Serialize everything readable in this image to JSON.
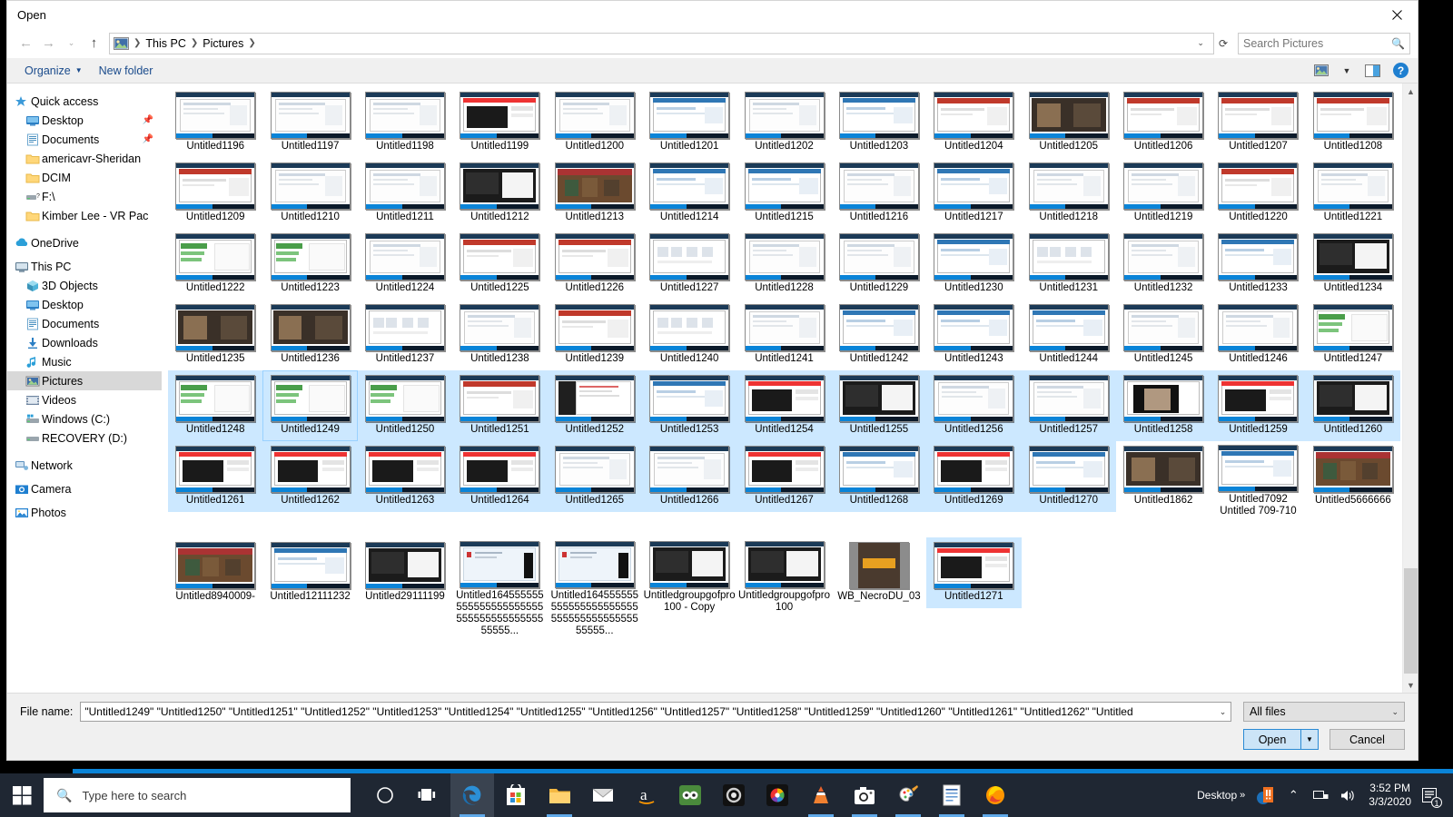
{
  "dialog": {
    "title": "Open",
    "close_label": "✕"
  },
  "nav": {
    "back_icon": "arrow-left-icon",
    "forward_icon": "arrow-right-icon",
    "history_icon": "chevron-down-icon",
    "up_icon": "arrow-up-icon",
    "breadcrumbs": [
      "This PC",
      "Pictures"
    ],
    "refresh_icon": "refresh-icon"
  },
  "search": {
    "placeholder": "Search Pictures",
    "value": "",
    "icon": "search-icon"
  },
  "commandbar": {
    "organize_label": "Organize",
    "new_folder_label": "New folder",
    "view_icon": "view-mode-icon",
    "view_caret": "▼",
    "preview_pane_icon": "preview-pane-icon",
    "help_label": "?"
  },
  "sidebar": {
    "items": [
      {
        "label": "Quick access",
        "icon": "star-pin-icon",
        "level": 0,
        "selected": false,
        "pinned": false
      },
      {
        "label": "Desktop",
        "icon": "desktop-icon",
        "level": 1,
        "selected": false,
        "pinned": true
      },
      {
        "label": "Documents",
        "icon": "documents-icon",
        "level": 1,
        "selected": false,
        "pinned": true
      },
      {
        "label": "americavr-Sheridan",
        "icon": "folder-icon",
        "level": 1,
        "selected": false,
        "pinned": false
      },
      {
        "label": "DCIM",
        "icon": "folder-icon",
        "level": 1,
        "selected": false,
        "pinned": false
      },
      {
        "label": "F:\\",
        "icon": "drive-unknown-icon",
        "level": 1,
        "selected": false,
        "pinned": false
      },
      {
        "label": "Kimber Lee - VR Pac",
        "icon": "folder-icon",
        "level": 1,
        "selected": false,
        "pinned": false
      },
      {
        "label": "OneDrive",
        "icon": "onedrive-icon",
        "level": 0,
        "selected": false,
        "pinned": false
      },
      {
        "label": "This PC",
        "icon": "this-pc-icon",
        "level": 0,
        "selected": false,
        "pinned": false
      },
      {
        "label": "3D Objects",
        "icon": "3d-objects-icon",
        "level": 1,
        "selected": false,
        "pinned": false
      },
      {
        "label": "Desktop",
        "icon": "desktop-icon",
        "level": 1,
        "selected": false,
        "pinned": false
      },
      {
        "label": "Documents",
        "icon": "documents-icon",
        "level": 1,
        "selected": false,
        "pinned": false
      },
      {
        "label": "Downloads",
        "icon": "downloads-icon",
        "level": 1,
        "selected": false,
        "pinned": false
      },
      {
        "label": "Music",
        "icon": "music-icon",
        "level": 1,
        "selected": false,
        "pinned": false
      },
      {
        "label": "Pictures",
        "icon": "pictures-icon",
        "level": 1,
        "selected": true,
        "pinned": false
      },
      {
        "label": "Videos",
        "icon": "videos-icon",
        "level": 1,
        "selected": false,
        "pinned": false
      },
      {
        "label": "Windows (C:)",
        "icon": "windows-drive-icon",
        "level": 1,
        "selected": false,
        "pinned": false
      },
      {
        "label": "RECOVERY (D:)",
        "icon": "drive-icon",
        "level": 1,
        "selected": false,
        "pinned": false
      },
      {
        "label": "Network",
        "icon": "network-icon",
        "level": 0,
        "selected": false,
        "pinned": false
      },
      {
        "label": "Camera",
        "icon": "camera-icon",
        "level": 0,
        "selected": false,
        "pinned": false
      },
      {
        "label": "Photos",
        "icon": "photos-icon",
        "level": 0,
        "selected": false,
        "pinned": false
      }
    ]
  },
  "filegrid": {
    "columns": 13,
    "rows": [
      {
        "files": [
          {
            "name": "Untitled1196",
            "selected": false,
            "style": "browser-light"
          },
          {
            "name": "Untitled1197",
            "selected": false,
            "style": "browser-light"
          },
          {
            "name": "Untitled1198",
            "selected": false,
            "style": "browser-light"
          },
          {
            "name": "Untitled1199",
            "selected": false,
            "style": "video-dark"
          },
          {
            "name": "Untitled1200",
            "selected": false,
            "style": "browser-light"
          },
          {
            "name": "Untitled1201",
            "selected": false,
            "style": "browser-blue"
          },
          {
            "name": "Untitled1202",
            "selected": false,
            "style": "browser-light"
          },
          {
            "name": "Untitled1203",
            "selected": false,
            "style": "browser-blue"
          },
          {
            "name": "Untitled1204",
            "selected": false,
            "style": "browser-red"
          },
          {
            "name": "Untitled1205",
            "selected": false,
            "style": "photo-dark"
          },
          {
            "name": "Untitled1206",
            "selected": false,
            "style": "browser-red"
          },
          {
            "name": "Untitled1207",
            "selected": false,
            "style": "browser-red"
          },
          {
            "name": "Untitled1208",
            "selected": false,
            "style": "browser-red"
          }
        ]
      },
      {
        "files": [
          {
            "name": "Untitled1209",
            "selected": false,
            "style": "browser-red"
          },
          {
            "name": "Untitled1210",
            "selected": false,
            "style": "browser-light"
          },
          {
            "name": "Untitled1211",
            "selected": false,
            "style": "browser-light"
          },
          {
            "name": "Untitled1212",
            "selected": false,
            "style": "browser-dark"
          },
          {
            "name": "Untitled1213",
            "selected": false,
            "style": "game-art"
          },
          {
            "name": "Untitled1214",
            "selected": false,
            "style": "browser-blue"
          },
          {
            "name": "Untitled1215",
            "selected": false,
            "style": "browser-blue"
          },
          {
            "name": "Untitled1216",
            "selected": false,
            "style": "browser-light"
          },
          {
            "name": "Untitled1217",
            "selected": false,
            "style": "browser-blue"
          },
          {
            "name": "Untitled1218",
            "selected": false,
            "style": "browser-light"
          },
          {
            "name": "Untitled1219",
            "selected": false,
            "style": "browser-light"
          },
          {
            "name": "Untitled1220",
            "selected": false,
            "style": "browser-red"
          },
          {
            "name": "Untitled1221",
            "selected": false,
            "style": "browser-light"
          }
        ]
      },
      {
        "files": [
          {
            "name": "Untitled1222",
            "selected": false,
            "style": "browser-green"
          },
          {
            "name": "Untitled1223",
            "selected": false,
            "style": "browser-green"
          },
          {
            "name": "Untitled1224",
            "selected": false,
            "style": "browser-light"
          },
          {
            "name": "Untitled1225",
            "selected": false,
            "style": "browser-red"
          },
          {
            "name": "Untitled1226",
            "selected": false,
            "style": "browser-red"
          },
          {
            "name": "Untitled1227",
            "selected": false,
            "style": "shop-grid"
          },
          {
            "name": "Untitled1228",
            "selected": false,
            "style": "browser-light"
          },
          {
            "name": "Untitled1229",
            "selected": false,
            "style": "browser-light"
          },
          {
            "name": "Untitled1230",
            "selected": false,
            "style": "browser-blue"
          },
          {
            "name": "Untitled1231",
            "selected": false,
            "style": "shop-grid"
          },
          {
            "name": "Untitled1232",
            "selected": false,
            "style": "browser-light"
          },
          {
            "name": "Untitled1233",
            "selected": false,
            "style": "browser-blue"
          },
          {
            "name": "Untitled1234",
            "selected": false,
            "style": "browser-dark"
          }
        ]
      },
      {
        "files": [
          {
            "name": "Untitled1235",
            "selected": false,
            "style": "photo-dark"
          },
          {
            "name": "Untitled1236",
            "selected": false,
            "style": "photo-dark"
          },
          {
            "name": "Untitled1237",
            "selected": false,
            "style": "shop-grid"
          },
          {
            "name": "Untitled1238",
            "selected": false,
            "style": "browser-light"
          },
          {
            "name": "Untitled1239",
            "selected": false,
            "style": "browser-red"
          },
          {
            "name": "Untitled1240",
            "selected": false,
            "style": "shop-grid"
          },
          {
            "name": "Untitled1241",
            "selected": false,
            "style": "browser-light"
          },
          {
            "name": "Untitled1242",
            "selected": false,
            "style": "browser-blue"
          },
          {
            "name": "Untitled1243",
            "selected": false,
            "style": "browser-blue"
          },
          {
            "name": "Untitled1244",
            "selected": false,
            "style": "browser-blue"
          },
          {
            "name": "Untitled1245",
            "selected": false,
            "style": "browser-light"
          },
          {
            "name": "Untitled1246",
            "selected": false,
            "style": "browser-light"
          },
          {
            "name": "Untitled1247",
            "selected": false,
            "style": "browser-green"
          }
        ]
      },
      {
        "files": [
          {
            "name": "Untitled1248",
            "selected": true,
            "style": "browser-green"
          },
          {
            "name": "Untitled1249",
            "selected": true,
            "focused": true,
            "style": "browser-green"
          },
          {
            "name": "Untitled1250",
            "selected": true,
            "style": "browser-green"
          },
          {
            "name": "Untitled1251",
            "selected": true,
            "style": "browser-red"
          },
          {
            "name": "Untitled1252",
            "selected": true,
            "style": "code-dark"
          },
          {
            "name": "Untitled1253",
            "selected": true,
            "style": "browser-blue"
          },
          {
            "name": "Untitled1254",
            "selected": true,
            "style": "video-dark"
          },
          {
            "name": "Untitled1255",
            "selected": true,
            "style": "browser-dark"
          },
          {
            "name": "Untitled1256",
            "selected": true,
            "style": "browser-light"
          },
          {
            "name": "Untitled1257",
            "selected": true,
            "style": "browser-light"
          },
          {
            "name": "Untitled1258",
            "selected": true,
            "style": "portrait-dark"
          },
          {
            "name": "Untitled1259",
            "selected": true,
            "style": "video-dark"
          },
          {
            "name": "Untitled1260",
            "selected": true,
            "style": "browser-dark"
          }
        ]
      },
      {
        "files": [
          {
            "name": "Untitled1261",
            "selected": true,
            "style": "video-dark"
          },
          {
            "name": "Untitled1262",
            "selected": true,
            "style": "video-dark"
          },
          {
            "name": "Untitled1263",
            "selected": true,
            "style": "video-dark"
          },
          {
            "name": "Untitled1264",
            "selected": true,
            "style": "video-dark"
          },
          {
            "name": "Untitled1265",
            "selected": true,
            "style": "browser-light"
          },
          {
            "name": "Untitled1266",
            "selected": true,
            "style": "browser-light"
          },
          {
            "name": "Untitled1267",
            "selected": true,
            "style": "video-dark"
          },
          {
            "name": "Untitled1268",
            "selected": true,
            "style": "browser-blue"
          },
          {
            "name": "Untitled1269",
            "selected": true,
            "style": "video-dark"
          },
          {
            "name": "Untitled1270",
            "selected": true,
            "style": "browser-blue"
          },
          {
            "name": "Untitled1862",
            "selected": false,
            "style": "photo-dark"
          },
          {
            "name": "Untitled7092\nUntitled 709-710",
            "selected": false,
            "style": "browser-blue"
          },
          {
            "name": "Untitled5666666",
            "selected": false,
            "style": "game-art"
          }
        ]
      },
      {
        "files": [
          {
            "name": "Untitled8940009-",
            "selected": false,
            "style": "game-art"
          },
          {
            "name": "Untitled12111232",
            "selected": false,
            "style": "browser-blue"
          },
          {
            "name": "Untitled29111199",
            "selected": false,
            "style": "browser-dark"
          },
          {
            "name": "Untitled16455555555555555555555555555555555555555555...",
            "selected": false,
            "style": "doc-pale"
          },
          {
            "name": "Untitled16455555555555555555555555555555555555555555...",
            "selected": false,
            "style": "doc-pale"
          },
          {
            "name": "Untitledgroupgofpro100 - Copy",
            "selected": false,
            "style": "browser-dark"
          },
          {
            "name": "Untitledgroupgofpro100",
            "selected": false,
            "style": "browser-dark"
          },
          {
            "name": "WB_NecroDU_03",
            "selected": false,
            "style": "necromunda"
          },
          {
            "name": "Untitled1271",
            "selected": true,
            "style": "video-dark"
          }
        ]
      }
    ]
  },
  "footer": {
    "filename_label": "File name:",
    "filename_value": "\"Untitled1249\" \"Untitled1250\" \"Untitled1251\" \"Untitled1252\" \"Untitled1253\" \"Untitled1254\" \"Untitled1255\" \"Untitled1256\" \"Untitled1257\" \"Untitled1258\" \"Untitled1259\" \"Untitled1260\" \"Untitled1261\" \"Untitled1262\" \"Untitled",
    "filetype_value": "All files",
    "open_label": "Open",
    "open_split_caret": "▼",
    "cancel_label": "Cancel",
    "dropdown_caret": "⌄"
  },
  "taskbar": {
    "start_icon": "windows-start-icon",
    "search_placeholder": "Type here to search",
    "search_icon": "search-icon",
    "items": [
      {
        "icon": "cortana-icon",
        "active": false
      },
      {
        "icon": "task-view-icon",
        "active": false
      },
      {
        "icon": "edge-icon",
        "active": true
      },
      {
        "icon": "microsoft-store-icon",
        "active": false
      },
      {
        "icon": "file-explorer-icon",
        "active": false
      },
      {
        "icon": "mail-icon",
        "active": false
      },
      {
        "icon": "amazon-icon",
        "active": false
      },
      {
        "icon": "tripadvisor-icon",
        "active": false
      },
      {
        "icon": "nvidia-icon",
        "active": false
      },
      {
        "icon": "color-wheel-icon",
        "active": false
      },
      {
        "icon": "vlc-icon",
        "active": false
      },
      {
        "icon": "camera-app-icon",
        "active": false
      },
      {
        "icon": "paint-icon",
        "active": false
      },
      {
        "icon": "word-icon",
        "active": false
      },
      {
        "icon": "firefox-icon",
        "active": false
      }
    ],
    "tray": {
      "desktop_label": "Desktop",
      "overflow_caret": "»",
      "chevron_icon": "chevron-up-icon",
      "network_icon": "network-tray-icon",
      "volume_icon": "volume-icon",
      "warning_icon": "warning-icon",
      "time": "3:52 PM",
      "date": "3/3/2020",
      "action_center_icon": "action-center-icon",
      "notification_count": "1"
    }
  }
}
